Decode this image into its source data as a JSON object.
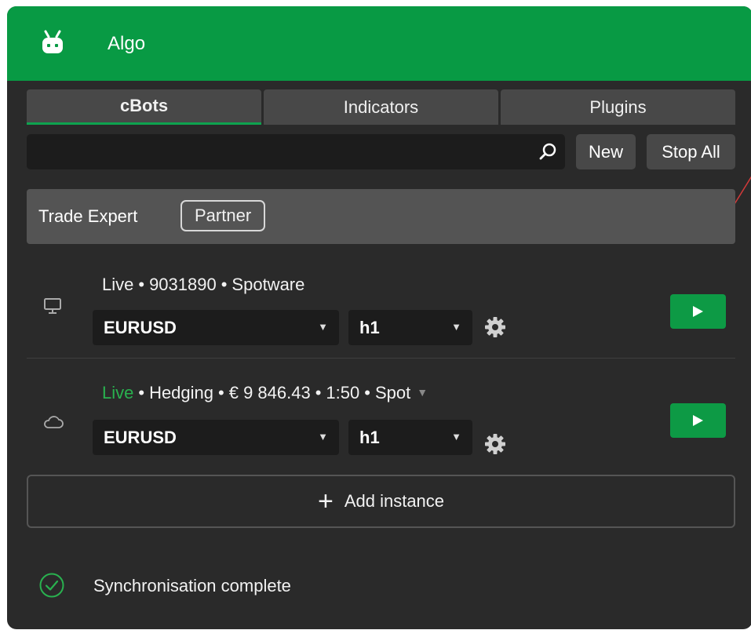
{
  "header": {
    "title": "Algo",
    "icon": "robot-icon",
    "color": "#089a44"
  },
  "tabs": [
    {
      "label": "cBots",
      "active": true
    },
    {
      "label": "Indicators",
      "active": false
    },
    {
      "label": "Plugins",
      "active": false
    }
  ],
  "search": {
    "value": "",
    "placeholder": "",
    "icon": "search-icon"
  },
  "toolbar": {
    "new_label": "New",
    "stop_all_label": "Stop All"
  },
  "group": {
    "name": "Trade Expert",
    "badge": "Partner"
  },
  "instances": [
    {
      "kind_icon": "monitor-icon",
      "status": "Live",
      "account": "9031890",
      "broker": "Spotware",
      "symbol": "EURUSD",
      "timeframe": "h1"
    },
    {
      "kind_icon": "cloud-icon",
      "status": "Live",
      "mode": "Hedging",
      "balance": "€ 9 846.43",
      "leverage": "1:50",
      "broker": "Spot",
      "symbol": "EURUSD",
      "timeframe": "h1"
    }
  ],
  "add_instance_label": "Add instance",
  "sync_status": "Synchronisation complete",
  "colors": {
    "accent": "#0d9a45",
    "live_green": "#29b14f",
    "panel": "#2a2a2a"
  }
}
